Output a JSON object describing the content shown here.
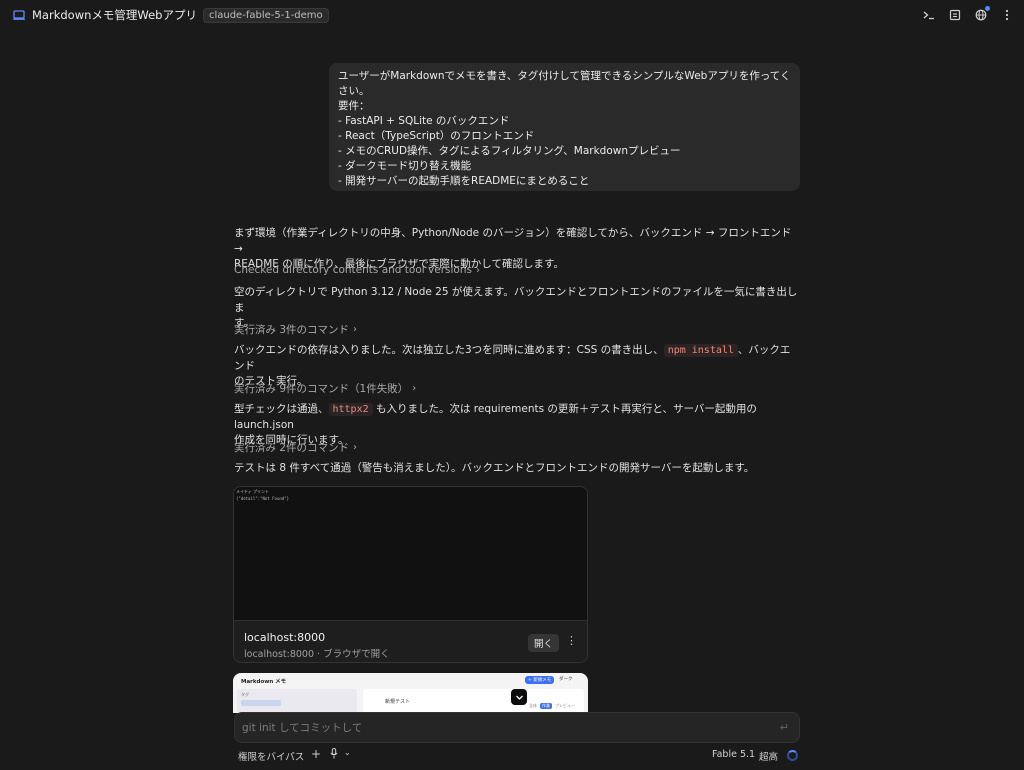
{
  "header": {
    "title": "Markdownメモ管理Webアプリ",
    "tag": "claude-fable-5-1-demo",
    "icons": [
      "terminal-icon",
      "panel-icon",
      "globe-icon",
      "more-icon"
    ]
  },
  "user_message": {
    "lines": [
      "ユーザーがMarkdownでメモを書き、タグ付けして管理できるシンプルなWebアプリを作ってくだ",
      "さい。",
      "要件：",
      "- FastAPI + SQLite のバックエンド",
      "- React（TypeScript）のフロントエンド",
      "- メモのCRUD操作、タグによるフィルタリング、Markdownプレビュー",
      "- ダークモード切り替え機能",
      "- 開発サーバーの起動手順をREADMEにまとめること"
    ]
  },
  "transcript": {
    "p1_l1": "まず環境（作業ディレクトリの中身、Python/Node のバージョン）を確認してから、バックエンド → フロントエンド →",
    "p1_l2": "README の順に作り、最後にブラウザで実際に動かして確認します。",
    "c1": "Checked directory contents and tool versions",
    "p2_l1": "空のディレクトリで Python 3.12 / Node 25 が使えます。バックエンドとフロントエンドのファイルを一気に書き出しま",
    "p2_l2": "す。",
    "c2": "実行済み 3件のコマンド",
    "p3_a": "バックエンドの依存は入りました。次は独立した3つを同時に進めます：CSS の書き出し、",
    "p3_code": "npm install",
    "p3_b": "、バックエンド",
    "p3_l2": "のテスト実行。",
    "c3": "実行済み 9件のコマンド（1件失敗）",
    "p4_a": "型チェックは通過、",
    "p4_code": "httpx2",
    "p4_b": " も入りました。次は requirements の更新＋テスト再実行と、サーバー起動用の launch.json",
    "p4_l2": "作成を同時に行います。",
    "c4": "実行済み 2件のコマンド",
    "p5": "テストは 8 件すべて通過（警告も消えました）。バックエンドとフロントエンドの開発サーバーを起動します。"
  },
  "preview": {
    "tab_label": "メイティ プリント",
    "json_text": "{\"detail\":\"Not Found\"}",
    "title": "localhost:8000",
    "subtitle": "localhost:8000 · ブラウザで開く",
    "open_label": "開く"
  },
  "preview2": {
    "logo": "Markdown メモ",
    "new_label": "+ 新規メモ",
    "dark_label": "ダーク",
    "side_label": "タグ",
    "main_title": "新規テスト",
    "chips": [
      "全体",
      "作業",
      "プレビュー"
    ]
  },
  "composer": {
    "placeholder": "git init してコミットして"
  },
  "footer": {
    "permission": "権限をバイパス",
    "model": "Fable 5.1",
    "effort": "超高"
  }
}
